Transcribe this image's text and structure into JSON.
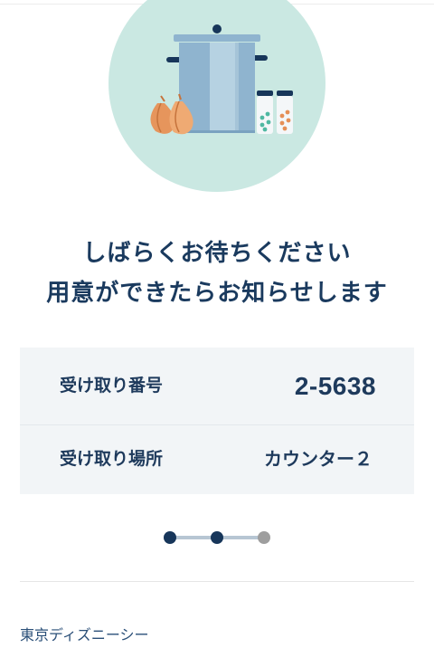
{
  "message": {
    "line1": "しばらくお待ちください",
    "line2": "用意ができたらお知らせします"
  },
  "receipt": {
    "number_label": "受け取り番号",
    "number_value": "2-5638",
    "place_label": "受け取り場所",
    "place_value": "カウンター２"
  },
  "progress": {
    "total_steps": 3,
    "completed_steps": 2,
    "colors": {
      "done": "#17365a",
      "pending": "#9e9e9e",
      "track": "#b7c6d3"
    }
  },
  "footer": {
    "link_label": "東京ディズニーシー"
  },
  "colors": {
    "hero_background": "#cae8e2",
    "card_background": "#f2f5f7",
    "text_primary": "#1e3a5c"
  },
  "icons": {
    "hero": "cooking-pot-illustration"
  }
}
